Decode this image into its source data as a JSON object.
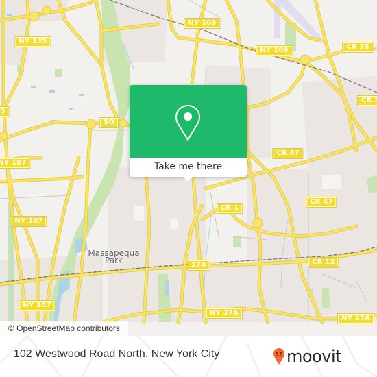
{
  "map": {
    "colors": {
      "background": "#f2f1ed",
      "residential": "#ebe6e2",
      "park": "#c9e4b1",
      "water": "#abd4ea",
      "road": "#f7e36d",
      "road_casing": "#e6cc3b",
      "rail": "#7a7a7a",
      "airport": "#e1dcf0"
    },
    "route_shields": [
      {
        "id": "ny109-a",
        "label": "NY 109"
      },
      {
        "id": "ny109-b",
        "label": "NY 109"
      },
      {
        "id": "ny135",
        "label": "NY 135"
      },
      {
        "id": "cr35-a",
        "label": "CR 35"
      },
      {
        "id": "cr35-b",
        "label": "CR 3"
      },
      {
        "id": "ny135-cut",
        "label": "5"
      },
      {
        "id": "so",
        "label": "SO"
      },
      {
        "id": "cr47-a",
        "label": "CR 47"
      },
      {
        "id": "cr47-b",
        "label": "CR 47"
      },
      {
        "id": "ny107-a",
        "label": "NY 107"
      },
      {
        "id": "ny107-b",
        "label": "NY 107"
      },
      {
        "id": "ny107-c",
        "label": "NY 107"
      },
      {
        "id": "cr1",
        "label": "CR 1"
      },
      {
        "id": "ny27a-a",
        "label": "27A"
      },
      {
        "id": "cr12",
        "label": "CR 12"
      },
      {
        "id": "ny27a-b",
        "label": "NY 27A"
      },
      {
        "id": "ny27a-c",
        "label": "NY 27A"
      }
    ],
    "place_labels": [
      {
        "id": "massapequa-park",
        "label": "Massapequa\nPark"
      }
    ],
    "place_label_lines": [
      "Massapequa",
      "Park"
    ]
  },
  "popup": {
    "icon": "location-pin-icon",
    "accent_color": "#1fb96b",
    "cta_label": "Take me there"
  },
  "attribution": {
    "text": "© OpenStreetMap contributors"
  },
  "footer": {
    "address": "102 Westwood Road North, New York City",
    "brand": {
      "name": "moovit",
      "logo_icon": "moovit-smiley-pin-icon",
      "logo_color": "#f26a36"
    }
  }
}
